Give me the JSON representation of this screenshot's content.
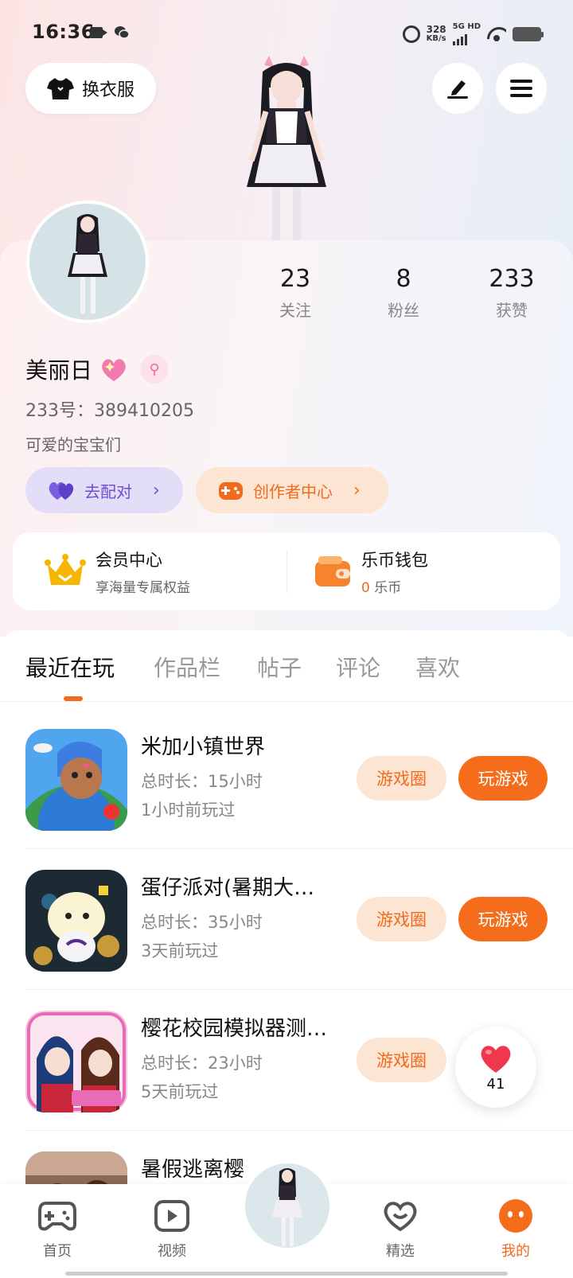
{
  "status_bar": {
    "time": "16:36",
    "speed_top": "328",
    "speed_unit": "KB/s",
    "network": "5G HD"
  },
  "top_actions": {
    "wardrobe_label": "换衣服"
  },
  "profile": {
    "stats": [
      {
        "value": "23",
        "label": "关注"
      },
      {
        "value": "8",
        "label": "粉丝"
      },
      {
        "value": "233",
        "label": "获赞"
      }
    ],
    "name": "美丽日",
    "gender_symbol": "⚲",
    "id_line": "233号：389410205",
    "bio": "可爱的宝宝们",
    "match_label": "去配对",
    "creator_label": "创作者中心",
    "chevron": "›"
  },
  "vip": {
    "member_title": "会员中心",
    "member_sub": "享海量专属权益",
    "wallet_title": "乐币钱包",
    "wallet_amount": "0",
    "wallet_unit": "乐币"
  },
  "tabs": [
    "最近在玩",
    "作品栏",
    "帖子",
    "评论",
    "喜欢"
  ],
  "games": [
    {
      "name": "米加小镇世界",
      "duration": "总时长：15小时",
      "last_played": "1小时前玩过",
      "circle_label": "游戏圈",
      "play_label": "玩游戏"
    },
    {
      "name": "蛋仔派对(暑期大…",
      "duration": "总时长：35小时",
      "last_played": "3天前玩过",
      "circle_label": "游戏圈",
      "play_label": "玩游戏"
    },
    {
      "name": "樱花校园模拟器测…",
      "duration": "总时长：23小时",
      "last_played": "5天前玩过",
      "circle_label": "游戏圈",
      "play_label": ""
    },
    {
      "name": "暑假逃离樱",
      "duration": "",
      "last_played": "",
      "circle_label": "",
      "play_label": ""
    }
  ],
  "like_float": {
    "count": "41"
  },
  "bottom_nav": [
    {
      "label": "首页"
    },
    {
      "label": "视频"
    },
    {
      "label": ""
    },
    {
      "label": "精选"
    },
    {
      "label": "我的"
    }
  ],
  "colors": {
    "accent": "#f26a1b",
    "match_purple": "#6a4fd4",
    "like_red": "#f0384d"
  }
}
